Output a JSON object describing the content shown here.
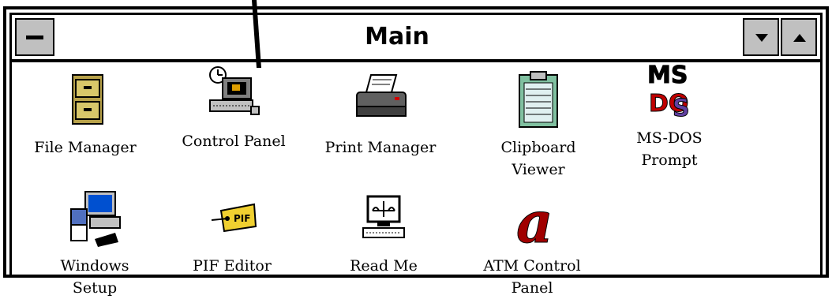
{
  "window": {
    "title": "Main"
  },
  "icons": [
    {
      "label": "File Manager",
      "icon": "file-cabinet-icon"
    },
    {
      "label": "Control Panel",
      "icon": "control-panel-icon"
    },
    {
      "label": "Print Manager",
      "icon": "printer-icon"
    },
    {
      "label": "Clipboard\nViewer",
      "icon": "clipboard-icon"
    },
    {
      "label": "MS-DOS\nPrompt",
      "icon": "ms-dos-icon"
    },
    {
      "label": "Windows\nSetup",
      "icon": "windows-setup-icon"
    },
    {
      "label": "PIF Editor",
      "icon": "pif-editor-icon"
    },
    {
      "label": "Read Me",
      "icon": "read-me-icon"
    },
    {
      "label": "ATM Control\nPanel",
      "icon": "atm-icon"
    }
  ]
}
